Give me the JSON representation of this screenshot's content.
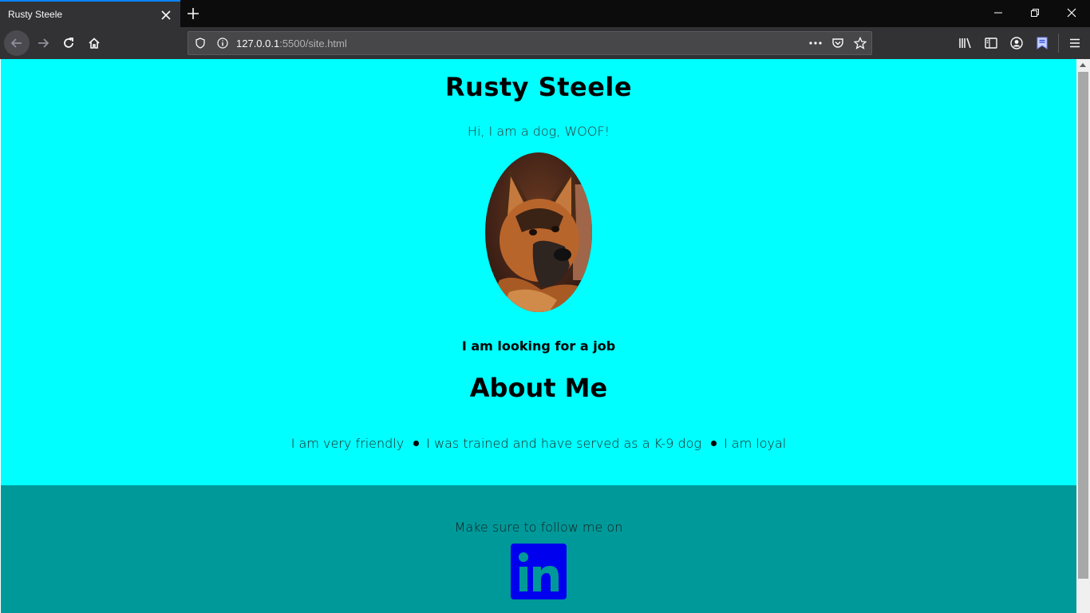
{
  "browser": {
    "tab_title": "Rusty Steele",
    "url_host": "127.0.0.1",
    "url_rest": ":5500/site.html"
  },
  "page": {
    "title": "Rusty Steele",
    "subtitle": "Hi, I am a dog, WOOF!",
    "job_line": "I am looking for a job",
    "about_heading": "About Me",
    "traits": [
      "I am very friendly",
      "I was trained and have served as a K-9 dog",
      "I am loyal"
    ],
    "footer_text": "Make sure to follow me on",
    "colors": {
      "hero_bg": "#00ffff",
      "footer_bg": "#009999",
      "linkedin_bg": "#0000ee"
    },
    "linkedin_icon": "linkedin-icon",
    "photo": "dog-photo"
  }
}
